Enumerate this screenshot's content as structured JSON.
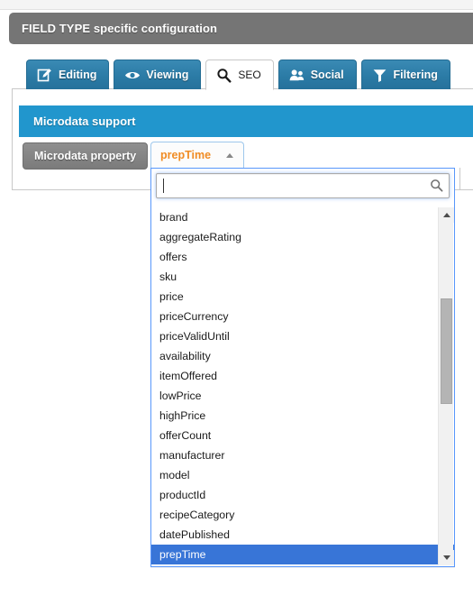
{
  "panel": {
    "header_title": "FIELD TYPE specific configuration"
  },
  "tabs": [
    {
      "label": "Editing",
      "icon": "edit-icon",
      "active": false
    },
    {
      "label": "Viewing",
      "icon": "eye-icon",
      "active": false
    },
    {
      "label": "SEO",
      "icon": "search-icon",
      "active": true
    },
    {
      "label": "Social",
      "icon": "people-icon",
      "active": false
    },
    {
      "label": "Filtering",
      "icon": "funnel-icon",
      "active": false
    }
  ],
  "section": {
    "title": "Microdata support",
    "property_button_label": "Microdata property"
  },
  "dropdown": {
    "selected_value": "prepTime",
    "caret_state": "up",
    "search_value": "",
    "search_placeholder": "",
    "search_icon": "magnifier-icon",
    "items": [
      "brand",
      "aggregateRating",
      "offers",
      "sku",
      "price",
      "priceCurrency",
      "priceValidUntil",
      "availability",
      "itemOffered",
      "lowPrice",
      "highPrice",
      "offerCount",
      "manufacturer",
      "model",
      "productId",
      "recipeCategory",
      "datePublished",
      "prepTime"
    ],
    "highlighted_item": "prepTime",
    "scrollbar": {
      "up_arrow": "scroll-up-arrow",
      "down_arrow": "scroll-down-arrow"
    }
  },
  "colors": {
    "header_gray": "#757575",
    "tab_blue": "#2b7ba6",
    "banner_blue": "#2196cd",
    "accent_orange": "#f08c24",
    "selection_blue": "#3875d7",
    "focus_blue": "#5897fb"
  }
}
